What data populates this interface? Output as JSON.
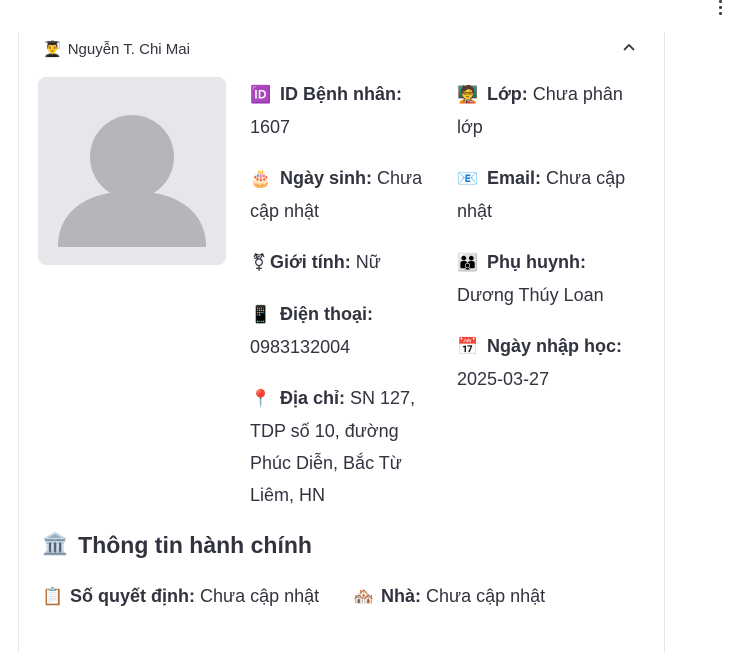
{
  "expander": {
    "title": "Nguyễn T. Chi Mai",
    "title_icon": "👨‍🎓",
    "expanded": true
  },
  "avatar": {
    "icon": "person-placeholder-icon"
  },
  "fields_left": [
    {
      "emoji": "🆔",
      "label": "ID Bệnh nhân:",
      "value": "1607"
    },
    {
      "emoji": "🎂",
      "label": "Ngày sinh:",
      "value": "Chưa cập nhật"
    },
    {
      "emoji": "⚧",
      "label": "Giới tính:",
      "value": "Nữ"
    },
    {
      "emoji": "📱",
      "label": "Điện thoại:",
      "value": "0983132004"
    },
    {
      "emoji": "📍",
      "label": "Địa chỉ:",
      "value": "SN 127, TDP số 10, đường Phúc Diễn, Bắc Từ Liêm, HN"
    }
  ],
  "fields_right": [
    {
      "emoji": "🧑‍🏫",
      "label": "Lớp:",
      "value": "Chưa phân lớp"
    },
    {
      "emoji": "📧",
      "label": "Email:",
      "value": "Chưa cập nhật"
    },
    {
      "emoji": "👪",
      "label": "Phụ huynh:",
      "value": "Dương Thúy Loan"
    },
    {
      "emoji": "📅",
      "label": "Ngày nhập học:",
      "value": "2025-03-27"
    }
  ],
  "admin_section": {
    "emoji": "🏛️",
    "title": "Thông tin hành chính",
    "items": [
      {
        "emoji": "📋",
        "label": "Số quyết định:",
        "value": "Chưa cập nhật"
      },
      {
        "emoji": "🏘️",
        "label": "Nhà:",
        "value": "Chưa cập nhật"
      }
    ]
  }
}
